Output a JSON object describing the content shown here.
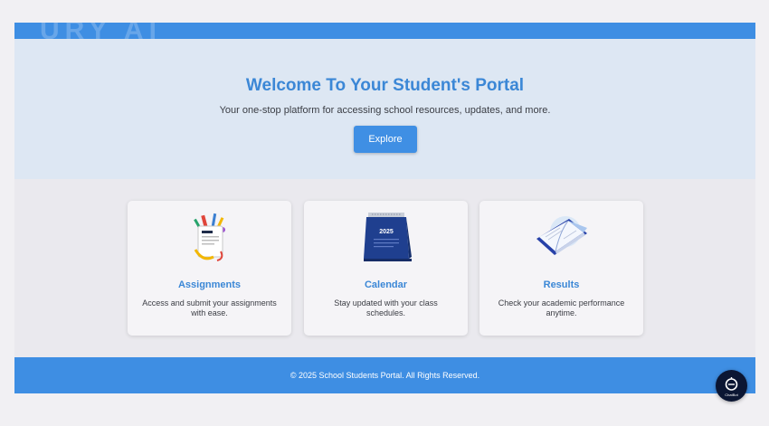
{
  "topbar": {
    "ghost_text": "URY AI"
  },
  "hero": {
    "title": "Welcome To Your Student's Portal",
    "subtitle": "Your one-stop platform for accessing school resources, updates, and more.",
    "button_label": "Explore"
  },
  "cards": [
    {
      "title": "Assignments",
      "description": "Access and submit your assignments with ease.",
      "icon": "assignments-icon"
    },
    {
      "title": "Calendar",
      "description": "Stay updated with your class schedules.",
      "icon": "calendar-icon",
      "icon_text": "2025"
    },
    {
      "title": "Results",
      "description": "Check your academic performance anytime.",
      "icon": "book-icon"
    }
  ],
  "footer": {
    "text": "© 2025 School Students Portal. All Rights Reserved."
  },
  "chatbot": {
    "label": "ChatBot",
    "icon": "chatbot-icon"
  },
  "colors": {
    "accent": "#3e8ee3",
    "heading": "#3b87d6",
    "hero_bg": "#dde7f3",
    "chatbot_bg": "#0b1633"
  }
}
